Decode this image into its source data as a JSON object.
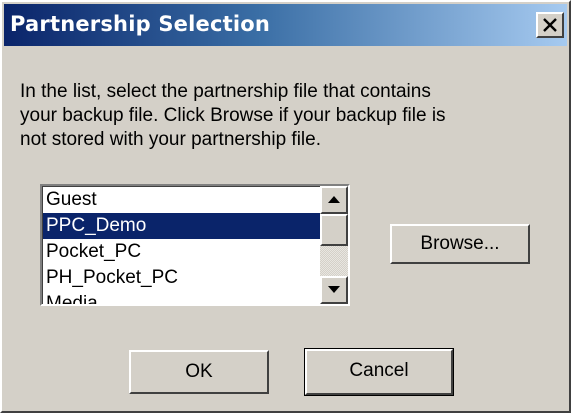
{
  "window": {
    "title": "Partnership Selection"
  },
  "instructions": {
    "line1": "In the list, select the partnership file that contains",
    "line2": "your backup file.  Click Browse if your backup file is",
    "line3": "not stored with your partnership file."
  },
  "partnership_list": {
    "items": [
      "Guest",
      "PPC_Demo",
      "Pocket_PC",
      "PH_Pocket_PC",
      "Media"
    ],
    "selected": "PPC_Demo"
  },
  "buttons": {
    "browse": "Browse...",
    "ok": "OK",
    "cancel": "Cancel"
  },
  "colors": {
    "title_gradient_start": "#0a246a",
    "title_gradient_end": "#a6caf0",
    "selection": "#0a246a",
    "face": "#d4d0c8"
  },
  "icons": {
    "close": "close-icon",
    "scroll_up": "arrow-up-icon",
    "scroll_down": "arrow-down-icon"
  }
}
